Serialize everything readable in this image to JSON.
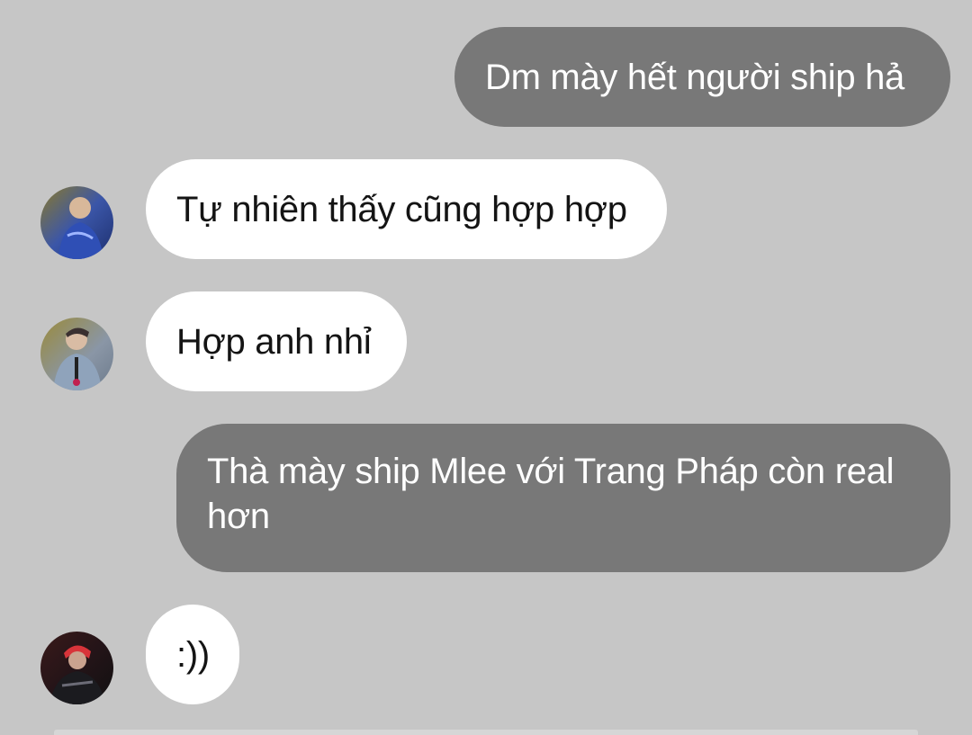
{
  "conversation": {
    "messages": [
      {
        "direction": "sent",
        "text": "Dm mày hết người ship hả"
      },
      {
        "direction": "received",
        "avatar": "avatar-1",
        "text": "Tự nhiên thấy cũng hợp hợp"
      },
      {
        "direction": "received",
        "avatar": "avatar-2",
        "text": "Hợp anh nhỉ"
      },
      {
        "direction": "sent",
        "text_line1": "Thà mày ship Mlee với Trang Pháp còn real",
        "text_line2": "hơn"
      },
      {
        "direction": "received",
        "avatar": "avatar-3",
        "text": ":))"
      }
    ]
  },
  "colors": {
    "background": "#c6c6c6",
    "sent_bubble": "#787878",
    "sent_text": "#ffffff",
    "received_bubble": "#ffffff",
    "received_text": "#141414"
  }
}
